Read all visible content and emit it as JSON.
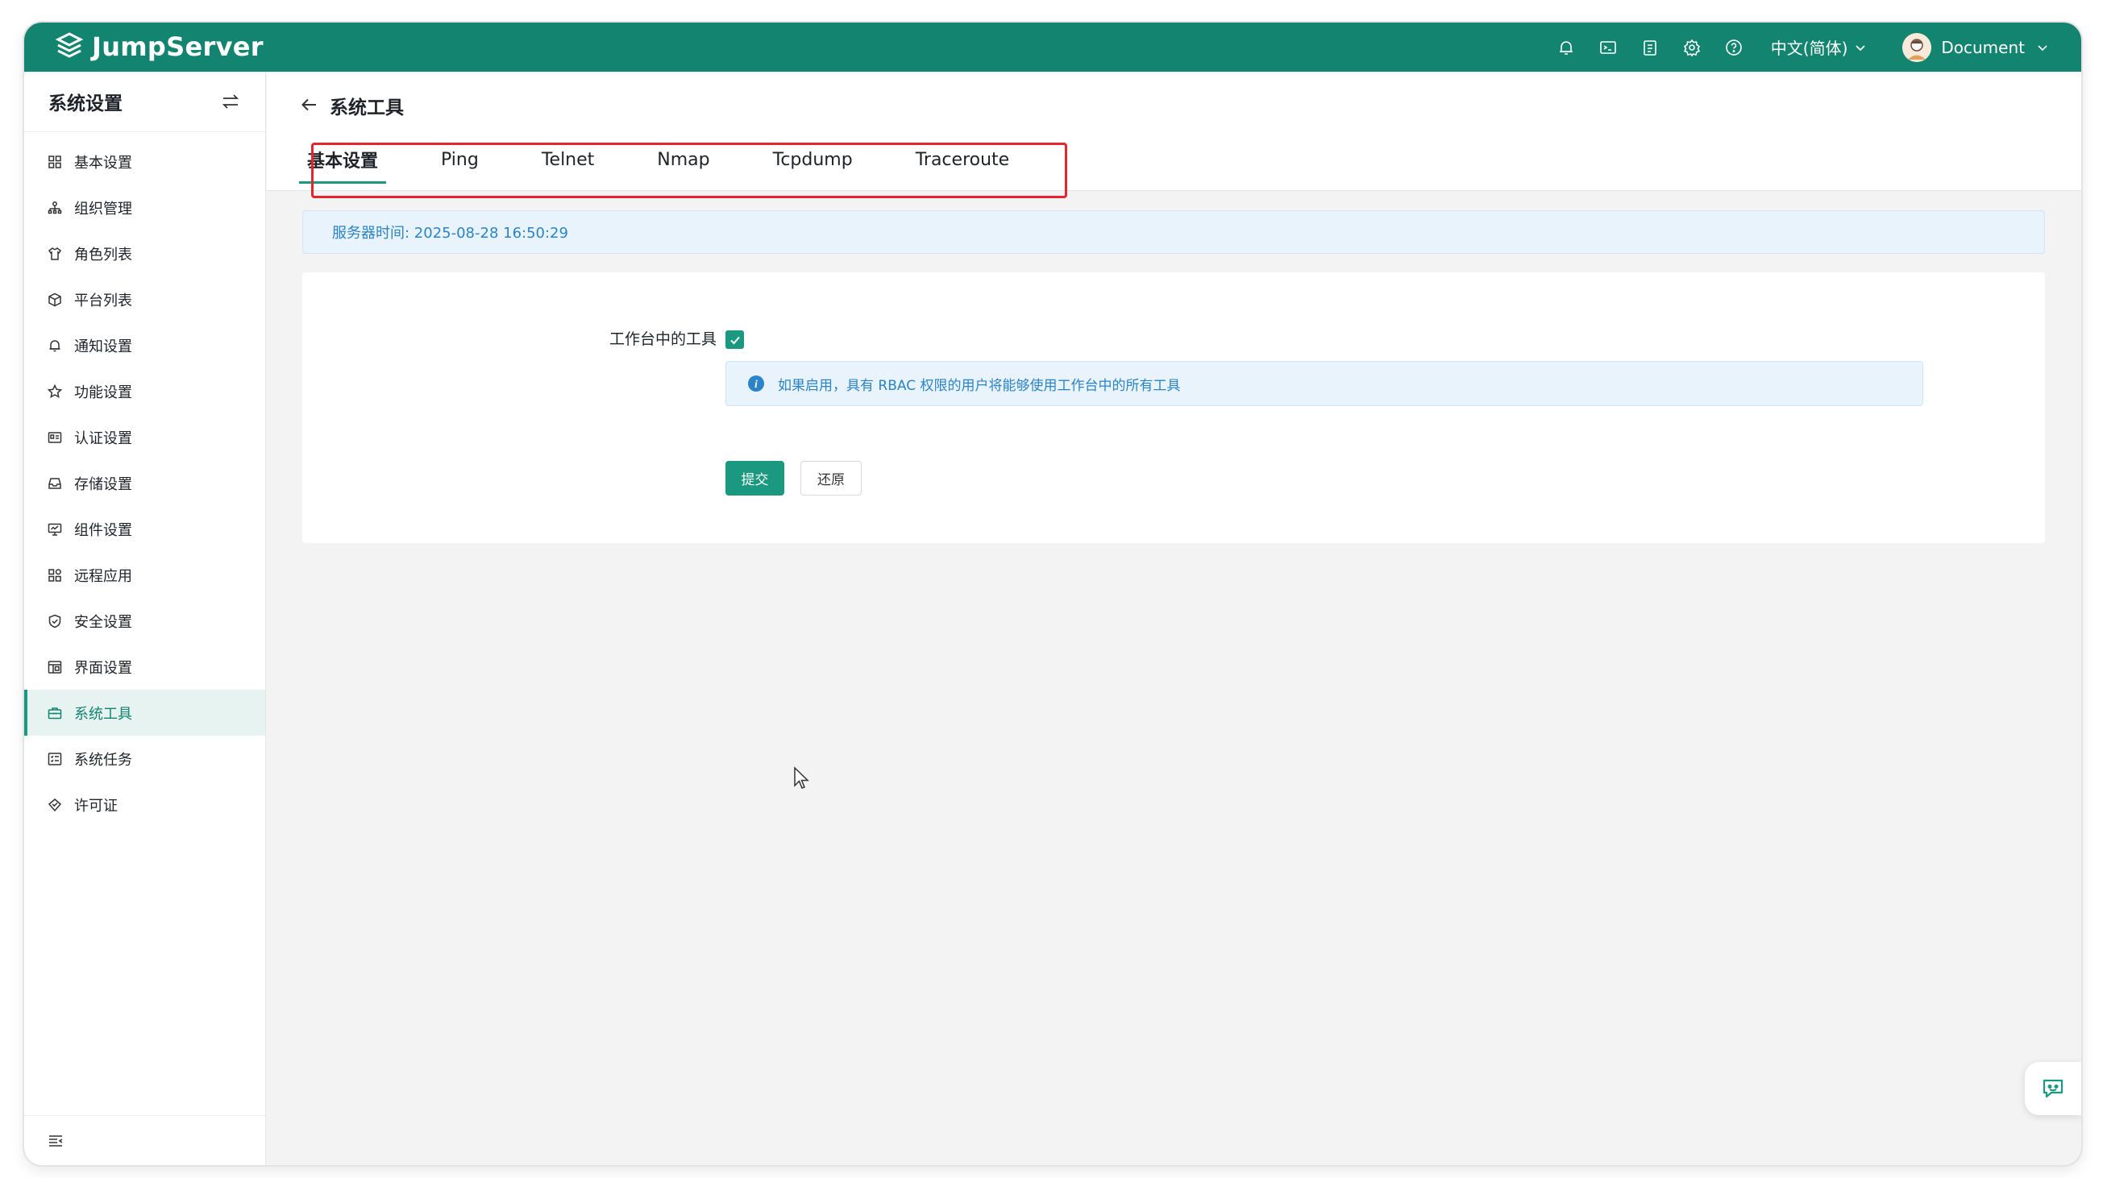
{
  "app": {
    "name": "JumpServer"
  },
  "topbar": {
    "icons": [
      "bell-icon",
      "terminal-icon",
      "clipboard-icon",
      "gear-icon",
      "help-icon"
    ],
    "language": "中文(简体)",
    "user": "Document"
  },
  "sidebar": {
    "title": "系统设置",
    "items": [
      {
        "label": "基本设置",
        "icon": "grid-icon"
      },
      {
        "label": "组织管理",
        "icon": "org-icon"
      },
      {
        "label": "角色列表",
        "icon": "shirt-icon"
      },
      {
        "label": "平台列表",
        "icon": "cube-icon"
      },
      {
        "label": "通知设置",
        "icon": "bell-icon"
      },
      {
        "label": "功能设置",
        "icon": "star-icon"
      },
      {
        "label": "认证设置",
        "icon": "id-card-icon"
      },
      {
        "label": "存储设置",
        "icon": "inbox-icon"
      },
      {
        "label": "组件设置",
        "icon": "monitor-icon"
      },
      {
        "label": "远程应用",
        "icon": "apps-icon"
      },
      {
        "label": "安全设置",
        "icon": "shield-icon"
      },
      {
        "label": "界面设置",
        "icon": "layout-icon"
      },
      {
        "label": "系统工具",
        "icon": "toolbox-icon",
        "active": true
      },
      {
        "label": "系统任务",
        "icon": "task-list-icon"
      },
      {
        "label": "许可证",
        "icon": "license-icon"
      }
    ]
  },
  "page": {
    "title": "系统工具",
    "tabs": [
      {
        "label": "基本设置",
        "active": true
      },
      {
        "label": "Ping"
      },
      {
        "label": "Telnet"
      },
      {
        "label": "Nmap"
      },
      {
        "label": "Tcpdump"
      },
      {
        "label": "Traceroute"
      }
    ],
    "server_time": "服务器时间: 2025-08-28 16:50:29"
  },
  "form": {
    "field_label": "工作台中的工具",
    "checked": true,
    "hint": "如果启用，具有 RBAC 权限的用户将能够使用工作台中的所有工具",
    "submit_label": "提交",
    "reset_label": "还原"
  },
  "colors": {
    "brand": "#138470",
    "accent": "#1a9980",
    "highlight_box": "#e5242c",
    "info_text": "#2b84c8"
  }
}
